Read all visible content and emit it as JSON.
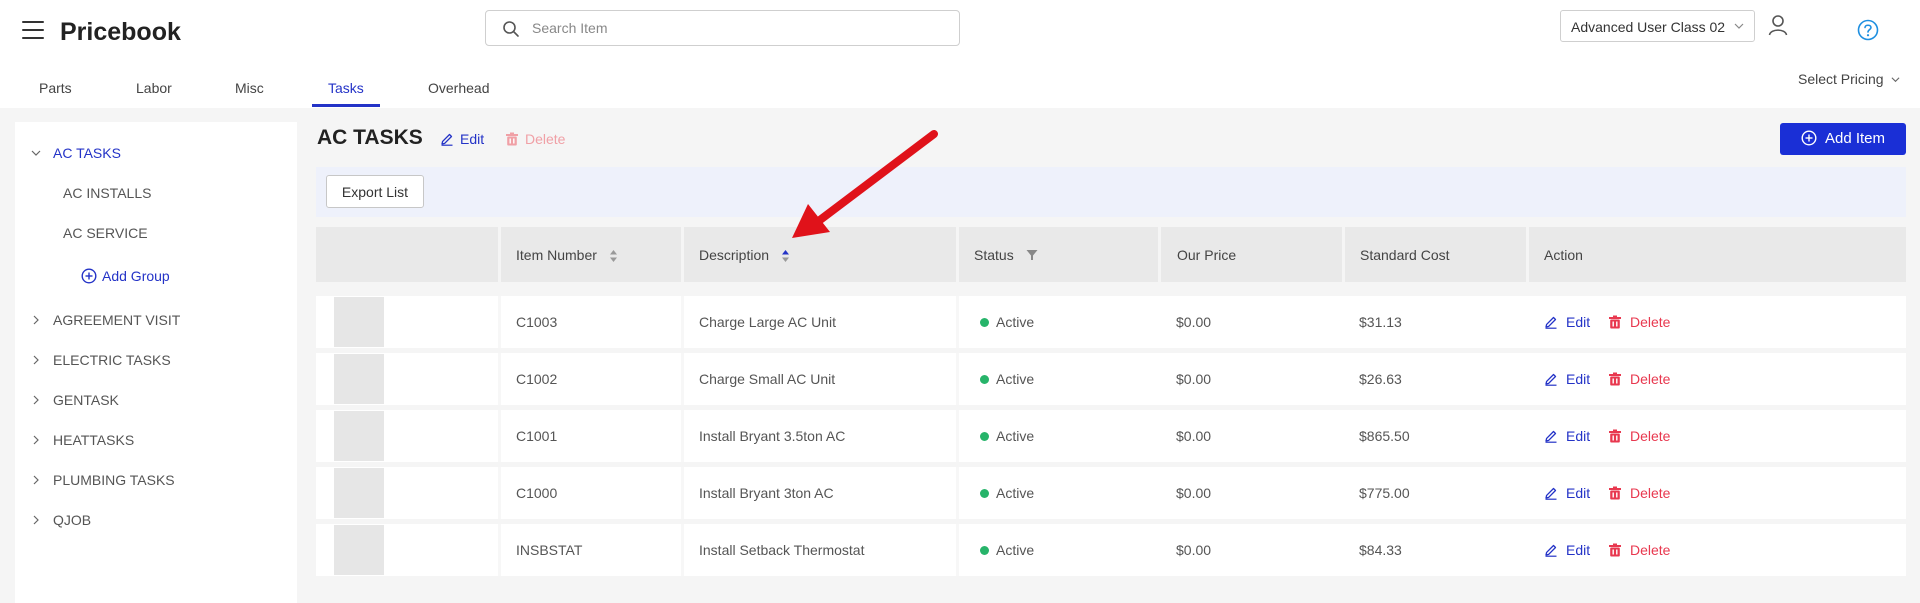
{
  "header": {
    "app_title": "Pricebook",
    "search_placeholder": "Search Item",
    "user_class": "Advanced User Class 02",
    "select_pricing": "Select Pricing"
  },
  "tabs": [
    "Parts",
    "Labor",
    "Misc",
    "Tasks",
    "Overhead"
  ],
  "active_tab": "Tasks",
  "sidebar": {
    "groups": [
      {
        "label": "AC TASKS",
        "expanded": true,
        "active": true
      },
      {
        "label": "AGREEMENT VISIT",
        "expanded": false
      },
      {
        "label": "ELECTRIC TASKS",
        "expanded": false
      },
      {
        "label": "GENTASK",
        "expanded": false
      },
      {
        "label": "HEATTASKS",
        "expanded": false
      },
      {
        "label": "PLUMBING TASKS",
        "expanded": false
      },
      {
        "label": "QJOB",
        "expanded": false
      }
    ],
    "subgroups": [
      "AC INSTALLS",
      "AC SERVICE"
    ],
    "add_group_label": "Add Group"
  },
  "main": {
    "title": "AC TASKS",
    "edit_label": "Edit",
    "delete_label": "Delete",
    "add_item_label": "Add Item",
    "export_label": "Export List"
  },
  "table": {
    "columns": [
      "Item Number",
      "Description",
      "Status",
      "Our Price",
      "Standard Cost",
      "Action"
    ],
    "rows": [
      {
        "item_number": "C1003",
        "description": "Charge Large AC Unit",
        "status": "Active",
        "our_price": "$0.00",
        "standard_cost": "$31.13"
      },
      {
        "item_number": "C1002",
        "description": "Charge Small AC Unit",
        "status": "Active",
        "our_price": "$0.00",
        "standard_cost": "$26.63"
      },
      {
        "item_number": "C1001",
        "description": "Install Bryant 3.5ton AC",
        "status": "Active",
        "our_price": "$0.00",
        "standard_cost": "$865.50"
      },
      {
        "item_number": "C1000",
        "description": "Install Bryant 3ton AC",
        "status": "Active",
        "our_price": "$0.00",
        "standard_cost": "$775.00"
      },
      {
        "item_number": "INSBSTAT",
        "description": "Install Setback Thermostat",
        "status": "Active",
        "our_price": "$0.00",
        "standard_cost": "$84.33"
      }
    ],
    "edit_label": "Edit",
    "delete_label": "Delete"
  },
  "colors": {
    "accent": "#2433c7",
    "primary_button": "#1a2fd6",
    "delete": "#e8384f",
    "status_active": "#27b46a",
    "annotation_arrow": "#e0121a"
  },
  "icons": [
    "menu-icon",
    "search-icon",
    "chevron-down-icon",
    "user-icon",
    "help-icon",
    "pencil-icon",
    "trash-icon",
    "plus-circle-icon",
    "sort-icon",
    "filter-icon",
    "chevron-right-icon"
  ]
}
